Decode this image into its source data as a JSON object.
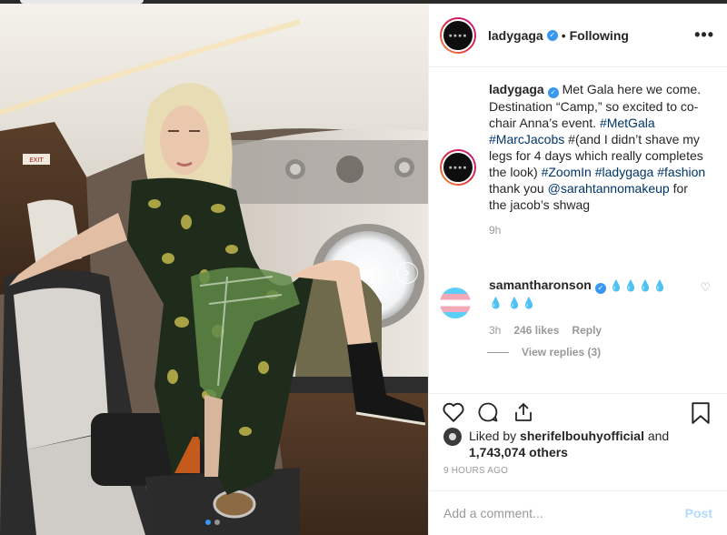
{
  "post": {
    "username": "ladygaga",
    "separator": "•",
    "follow_status": "Following",
    "more_label": "•••"
  },
  "caption": {
    "username": "ladygaga",
    "text_1": "Met Gala here we come. Destination “Camp,” so excited to co-chair Anna’s event.",
    "tag_metgala": "#MetGala",
    "tag_marcjacobs": "#MarcJacobs",
    "text_2": "#(and I didn’t shave my legs for 4 days which really completes the look)",
    "tag_zoomin": "#ZoomIn",
    "tag_ladygaga": "#ladygaga",
    "tag_fashion": "#fashion",
    "text_3": "thank you",
    "mention": "@sarahtannomakeup",
    "text_4": "for the jacob’s shwag",
    "age": "9h"
  },
  "comment": {
    "username": "samantharonson",
    "text": "💧💧💧💧💧 💧💧",
    "age": "3h",
    "likes": "246 likes",
    "reply_label": "Reply",
    "view_replies": "View replies (3)"
  },
  "likes": {
    "prefix": "Liked by",
    "user": "sherifelbouhyofficial",
    "conj": "and",
    "count": "1,743,074 others"
  },
  "timestamp": "9 HOURS AGO",
  "add_comment": {
    "placeholder": "Add a comment...",
    "post_label": "Post"
  },
  "carousel": {
    "current_index": 1,
    "total": 2
  },
  "colors": {
    "accent": "#3897f0",
    "link": "#003569",
    "muted": "#999999",
    "post_disabled": "#b3dbff"
  }
}
